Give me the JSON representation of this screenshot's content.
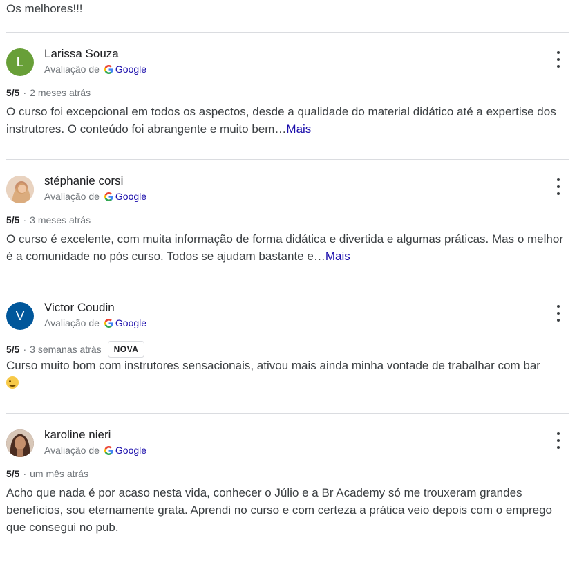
{
  "top_text": "Os melhores!!!",
  "colors": {
    "link": "#1a0dab",
    "muted": "#70757a"
  },
  "reviews": [
    {
      "author": "Larissa Souza",
      "avatar_letter": "L",
      "avatar_color": "#689f38",
      "source_prefix": "Avaliação de",
      "source_name": "Google",
      "rating": "5/5",
      "separator": "·",
      "time": "2 meses atrás",
      "badge": "",
      "text": "O curso foi excepcional em todos os aspectos, desde a qualidade do material didático até a expertise dos instrutores. O conteúdo foi abrangente e muito bem…",
      "more_link": "Mais"
    },
    {
      "author": "stéphanie corsi",
      "avatar_letter": "",
      "avatar_color": "#d9b59a",
      "source_prefix": "Avaliação de",
      "source_name": "Google",
      "rating": "5/5",
      "separator": "·",
      "time": "3 meses atrás",
      "badge": "",
      "text": "O curso é excelente, com muita informação de forma didática e divertida e algumas práticas. Mas o melhor é a comunidade no pós curso. Todos se ajudam bastante e…",
      "more_link": "Mais"
    },
    {
      "author": "Victor Coudin",
      "avatar_letter": "V",
      "avatar_color": "#01579b",
      "source_prefix": "Avaliação de",
      "source_name": "Google",
      "rating": "5/5",
      "separator": "·",
      "time": "3 semanas atrás",
      "badge": "NOVA",
      "text": "Curso muito bom com instrutores sensacionais, ativou mais ainda minha vontade de trabalhar com bar",
      "more_link": ""
    },
    {
      "author": "karoline nieri",
      "avatar_letter": "",
      "avatar_color": "#6d4c41",
      "source_prefix": "Avaliação de",
      "source_name": "Google",
      "rating": "5/5",
      "separator": "·",
      "time": "um mês atrás",
      "badge": "",
      "text": "Acho que nada é por acaso nesta vida, conhecer o Júlio e a Br Academy só me trouxeram grandes benefícios, sou eternamente grata. Aprendi no curso e com certeza a prática veio depois com o emprego que consegui no pub.",
      "more_link": ""
    }
  ]
}
